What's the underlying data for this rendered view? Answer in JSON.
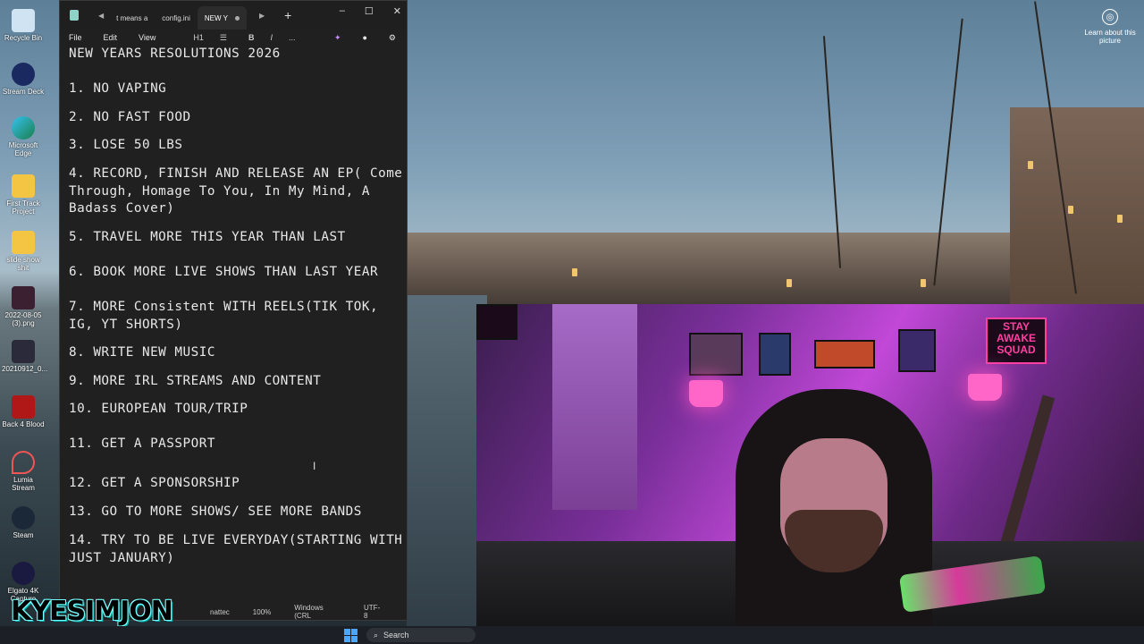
{
  "desktop": {
    "learn_text": "Learn about this picture",
    "icons": [
      {
        "label": "Recycle Bin",
        "icon": "recycle-bin-icon"
      },
      {
        "label": "Stream Deck",
        "icon": "stream-deck-icon"
      },
      {
        "label": "Microsoft Edge",
        "icon": "edge-icon"
      },
      {
        "label": "First Track Project",
        "icon": "folder-icon"
      },
      {
        "label": "slide show shit",
        "icon": "folder-icon"
      },
      {
        "label": "2022-08-05 (3).png",
        "icon": "image-file-icon"
      },
      {
        "label": "20210912_0...",
        "icon": "image-file-icon"
      },
      {
        "label": "Back 4 Blood",
        "icon": "game-icon"
      },
      {
        "label": "Lumia Stream",
        "icon": "lumia-icon"
      },
      {
        "label": "Steam",
        "icon": "steam-icon"
      },
      {
        "label": "Elgato 4K Capture",
        "icon": "elgato-icon"
      }
    ]
  },
  "notepad": {
    "tabs": [
      {
        "label": "t means a"
      },
      {
        "label": "config.ini"
      },
      {
        "label": "NEW Y"
      }
    ],
    "menu": {
      "file": "File",
      "edit": "Edit",
      "view": "View",
      "heading": "H1",
      "bold": "B",
      "italic": "I",
      "more": "..."
    },
    "lines": [
      "NEW YEARS RESOLUTIONS 2026",
      "1. NO VAPING",
      "2. NO FAST FOOD",
      "3. LOSE 50 LBS",
      "4. RECORD, FINISH AND RELEASE AN EP( Come Through, Homage To You, In My Mind, A Badass Cover)",
      "5. TRAVEL MORE THIS YEAR THAN LAST",
      "6. BOOK MORE LIVE SHOWS THAN LAST YEAR",
      "7. MORE Consistent WITH REELS(TIK TOK, IG, YT SHORTS)",
      "8. WRITE NEW MUSIC",
      "9. MORE IRL STREAMS AND CONTENT",
      "10. EUROPEAN TOUR/TRIP",
      "11. GET A PASSPORT",
      "12. GET A SPONSORSHIP",
      "13. GO TO MORE SHOWS/ SEE MORE BANDS",
      "14. TRY TO BE LIVE EVERYDAY(STARTING WITH JUST JANUARY)"
    ],
    "status": {
      "format": "nattec",
      "zoom": "100%",
      "line_ending": "Windows (CRL",
      "encoding": "UTF-8"
    }
  },
  "webcam": {
    "sign_text": "STAY AWAKE SQUAD"
  },
  "overlay": {
    "streamer_name": "KYESIMJON"
  },
  "taskbar": {
    "search_label": "Search"
  }
}
